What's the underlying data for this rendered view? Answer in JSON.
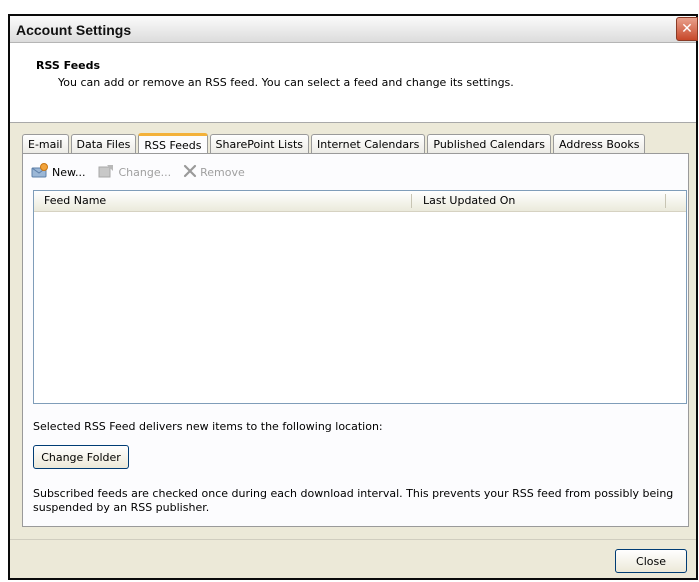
{
  "window": {
    "title": "Account Settings",
    "close_glyph": "✕"
  },
  "header": {
    "title": "RSS Feeds",
    "description": "You can add or remove an RSS feed. You can select a feed and change its settings."
  },
  "tabs": [
    {
      "label": "E-mail"
    },
    {
      "label": "Data Files"
    },
    {
      "label": "RSS Feeds",
      "active": true
    },
    {
      "label": "SharePoint Lists"
    },
    {
      "label": "Internet Calendars"
    },
    {
      "label": "Published Calendars"
    },
    {
      "label": "Address Books"
    }
  ],
  "toolbar": {
    "new_label": "New...",
    "change_label": "Change...",
    "remove_label": "Remove",
    "new_icon": "rss-new-icon",
    "change_icon": "change-icon",
    "remove_icon": "remove-x-icon"
  },
  "list": {
    "columns": [
      "Feed Name",
      "Last Updated On"
    ],
    "rows": []
  },
  "location_text": "Selected RSS Feed delivers new items to the following location:",
  "change_folder_label": "Change Folder",
  "info_text_line1": "Subscribed feeds are checked once during each download interval. This prevents your RSS feed from possibly being",
  "info_text_line2": "suspended by an RSS publisher.",
  "close_label": "Close",
  "colors": {
    "active_tab_accent": "#f3b13a",
    "list_border": "#7f9db9",
    "dialog_bg": "#ece9d8"
  }
}
